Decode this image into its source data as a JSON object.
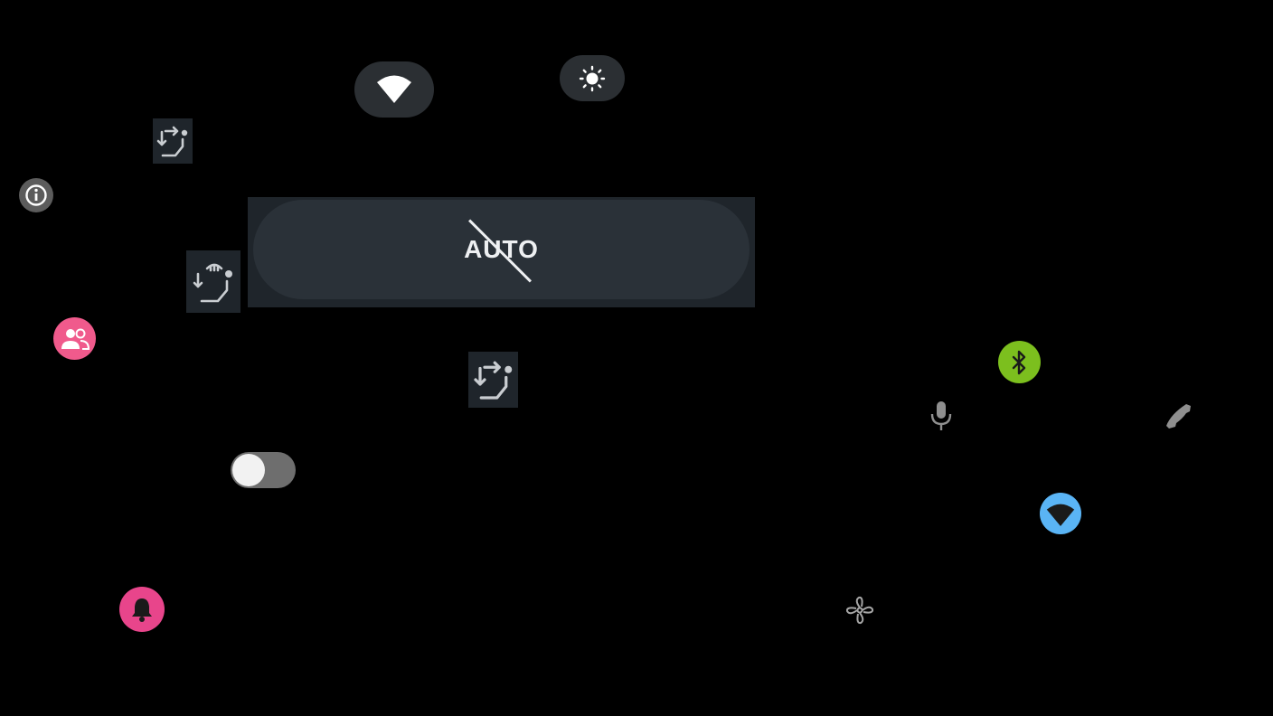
{
  "climate": {
    "auto_label": "AUTO",
    "auto_state": "off"
  },
  "toggle": {
    "state": "off"
  },
  "colors": {
    "background": "#000000",
    "pill": "#2b2f33",
    "tile": "#1f252b",
    "pink": "#f05a8c",
    "bell_pink": "#e8458b",
    "bluetooth_green": "#7cbf1e",
    "wifi_blue": "#5ab4f5",
    "info_gray": "#5c5c5c"
  },
  "icons": [
    "wifi-icon",
    "brightness-icon",
    "seat-airflow-icon",
    "info-icon",
    "seat-heat-icon",
    "people-icon",
    "bluetooth-icon",
    "mic-icon",
    "phone-icon",
    "bell-icon",
    "fan-icon"
  ]
}
